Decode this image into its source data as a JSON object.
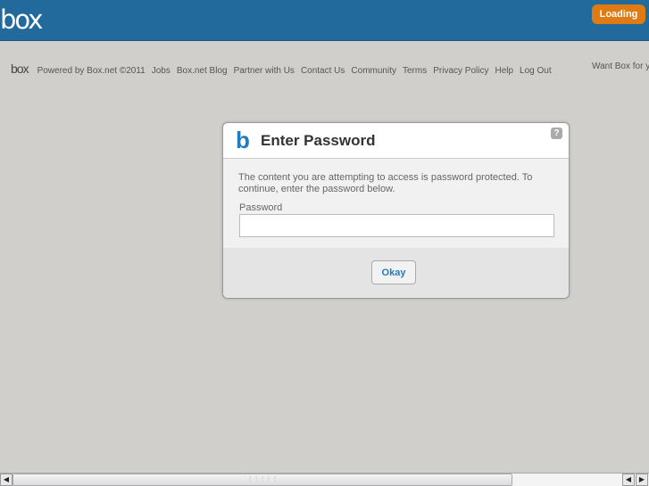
{
  "header": {
    "logo": "box",
    "loading_label": "Loading"
  },
  "footer": {
    "logo": "box",
    "links": [
      "Powered by Box.net ©2011",
      "Jobs",
      "Box.net Blog",
      "Partner with Us",
      "Contact Us",
      "Community",
      "Terms",
      "Privacy Policy",
      "Help",
      "Log Out"
    ],
    "promo": "Want Box for y"
  },
  "dialog": {
    "logo": "b",
    "title": "Enter Password",
    "help_icon": "?",
    "message": "The content you are attempting to access is password protected. To continue, enter the password below.",
    "password_label": "Password",
    "password_value": "",
    "okay_label": "Okay"
  },
  "colors": {
    "header": "#236a9c",
    "loading": "#e07a12",
    "accent": "#1e7cc2"
  },
  "scrollbar": {
    "grip": "⋮⋮⋮⋮⋮"
  }
}
